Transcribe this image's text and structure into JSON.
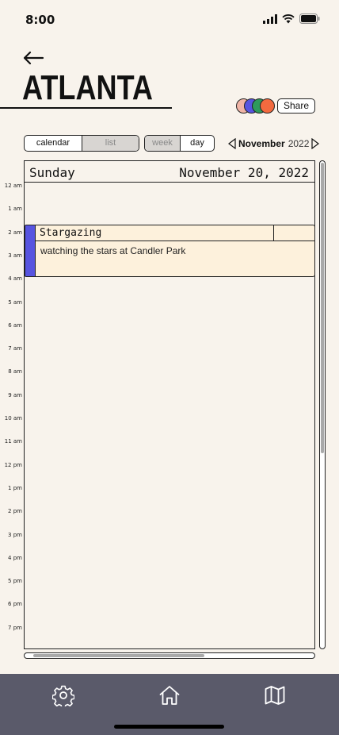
{
  "status_bar": {
    "time": "8:00"
  },
  "header": {
    "city": "ATLANTA",
    "share_label": "Share",
    "avatars": [
      {
        "name": "avatar-1",
        "color": "#f0b4a6"
      },
      {
        "name": "avatar-2",
        "color": "#5754e0"
      },
      {
        "name": "avatar-3",
        "color": "#2e9a5c"
      },
      {
        "name": "avatar-4",
        "color": "#f26a3f"
      }
    ]
  },
  "view_toggle": {
    "calendar": "calendar",
    "list": "list",
    "week": "week",
    "day": "day",
    "selected_view": "calendar",
    "selected_range": "day"
  },
  "month_nav": {
    "month": "November",
    "year": "2022"
  },
  "calendar": {
    "day_name": "Sunday",
    "date": "November 20, 2022",
    "hours": [
      "12 am",
      "1 am",
      "2 am",
      "3 am",
      "4 am",
      "5 am",
      "6 am",
      "7 am",
      "8 am",
      "9 am",
      "10 am",
      "11 am",
      "12 pm",
      "1 pm",
      "2 pm",
      "3 pm",
      "4 pm",
      "5 pm",
      "6 pm",
      "7 pm"
    ]
  },
  "event": {
    "title": "Stargazing",
    "description": "watching the stars at Candler Park",
    "color": "#5754e0"
  },
  "bottom_nav": {
    "icons": [
      "gear-icon",
      "home-icon",
      "map-icon"
    ]
  }
}
